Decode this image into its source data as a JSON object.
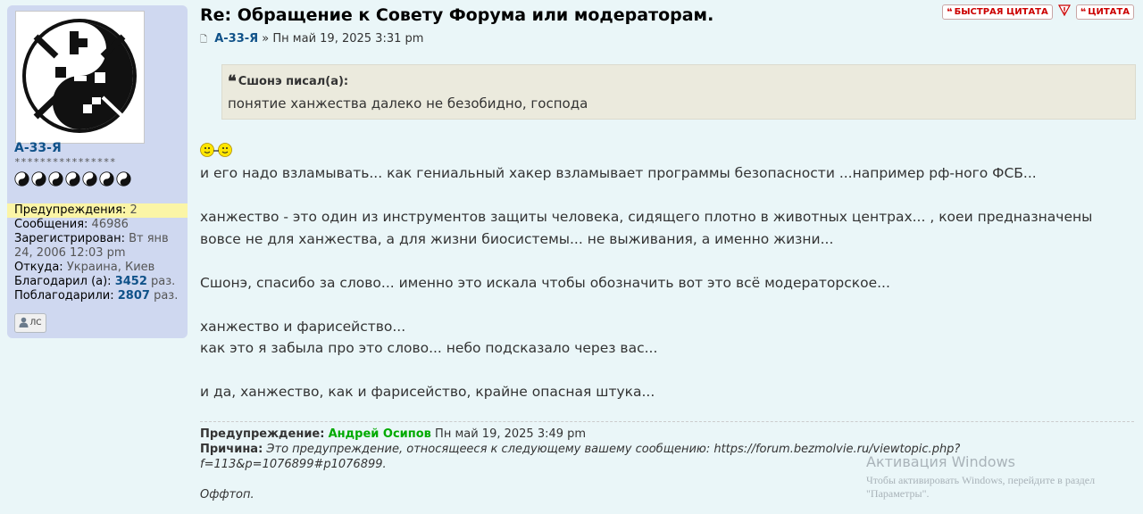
{
  "post": {
    "title": "Re: Обращение к Совету Форума или модераторам.",
    "author": "А-33-Я",
    "separator": "»",
    "date": "Пн май 19, 2025 3:31 pm",
    "buttons": {
      "quick_quote": "БЫСТРАЯ ЦИТАТА",
      "report": "!",
      "quote": "ЦИТАТА"
    },
    "quote": {
      "cite": "Сшонэ писал(а):",
      "text": "понятие ханжества далеко не безобидно, господа"
    },
    "paragraphs": [
      "и его надо взламывать... как гениальный хакер взламывает программы безопасности ...например рф-ного ФСБ...",
      "ханжество - это один из инструментов защиты человека, сидящего плотно в животных центрах... , коеи предназначены вовсе не для ханжества, а для жизни биосистемы... не выживания, а именно жизни...",
      "Сшонэ, спасибо за слово... именно это искала чтобы обозначить вот это всё модераторское...",
      "ханжество и фарисейство...\nкак это я забыла про это слово... небо подсказало через вас...",
      "и да, ханжество, как и фарисейство, крайне опасная штука..."
    ],
    "warning": {
      "label": "Предупреждение:",
      "moderator": "Андрей Осипов",
      "date": "Пн май 19, 2025 3:49 pm",
      "reason_label": "Причина:",
      "reason": "Это предупреждение, относящееся к следующему вашему сообщению: https://forum.bezmolvie.ru/viewtopic.php?f=113&p=1076899#p1076899.",
      "note": "Оффтоп."
    }
  },
  "profile": {
    "username": "А-33-Я",
    "rank_stars": "****************",
    "yinyang_count": 7,
    "warnings_label": "Предупреждения:",
    "warnings_value": "2",
    "posts_label": "Сообщения:",
    "posts_value": "46986",
    "registered_label": "Зарегистрирован:",
    "registered_value": "Вт янв 24, 2006 12:03 pm",
    "from_label": "Откуда:",
    "from_value": "Украина, Киев",
    "thanked_label": "Благодарил (а):",
    "thanked_value": "3452",
    "thanked_by_label": "Поблагодарили:",
    "thanked_by_value": "2807",
    "times": "раз.",
    "pm_label": "ЛС"
  },
  "watermark": {
    "line1": "Активация Windows",
    "line2": "Чтобы активировать Windows, перейдите в раздел",
    "line3": "\"Параметры\"."
  },
  "colors": {
    "accent": "#105289",
    "moderator": "#00aa00",
    "warning_bg": "#fbf5a6",
    "quote_bg": "#ebeadd",
    "profile_bg": "#cfd8f0"
  }
}
